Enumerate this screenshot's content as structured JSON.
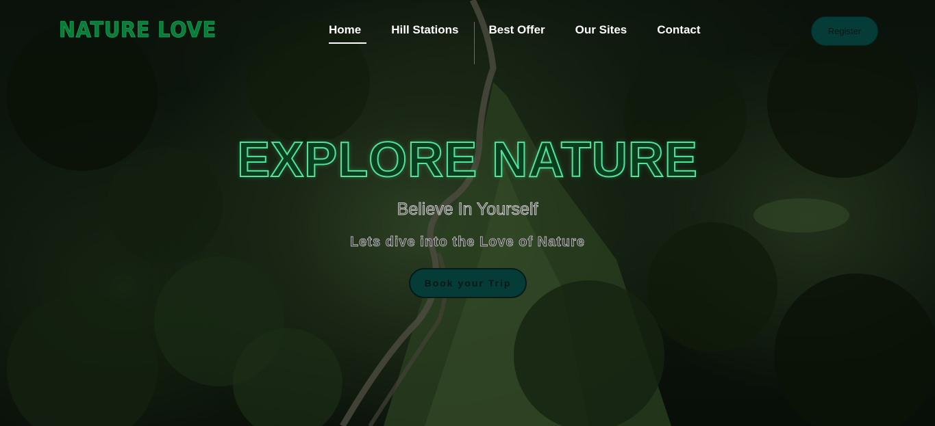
{
  "brand": {
    "logo_text": "NATURE LOVE"
  },
  "nav": {
    "items": [
      {
        "label": "Home",
        "active": true
      },
      {
        "label": "Hill Stations",
        "active": false
      },
      {
        "label": "Best Offer",
        "active": false
      },
      {
        "label": "Our Sites",
        "active": false
      },
      {
        "label": "Contact",
        "active": false
      }
    ],
    "register_label": "Register"
  },
  "hero": {
    "title": "EXPLORE NATURE",
    "subtitle": "Believe In Yourself",
    "tagline": "Lets dive into the Love of Nature",
    "cta_label": "Book your Trip"
  },
  "colors": {
    "logo": "#0b7a3a",
    "title_outline": "#52e59a",
    "button_bg": "#053c38",
    "nav_text": "#ffffff"
  }
}
